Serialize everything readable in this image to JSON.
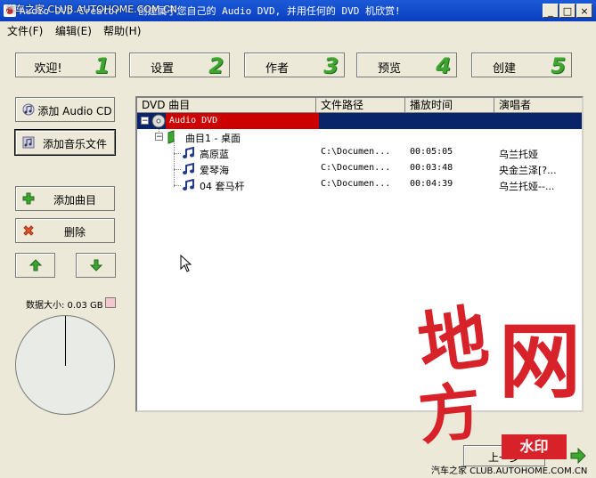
{
  "window": {
    "title": "Audio DVD Creator - 创建属于您自己的 Audio DVD, 并用任何的 DVD 机欣赏!",
    "overlay_text": "汽车之家 CLUB.AUTOHOME.COM.CN"
  },
  "window_controls": {
    "minimize": "_",
    "maximize": "□",
    "close": "×"
  },
  "menu": {
    "items": [
      "文件(F)",
      "编辑(E)",
      "帮助(H)"
    ]
  },
  "steps": [
    {
      "label": "欢迎!",
      "number": "1"
    },
    {
      "label": "设置",
      "number": "2"
    },
    {
      "label": "作者",
      "number": "3"
    },
    {
      "label": "预览",
      "number": "4"
    },
    {
      "label": "创建",
      "number": "5"
    }
  ],
  "side_buttons": {
    "add_audio_cd": "添加 Audio CD",
    "add_music_file": "添加音乐文件",
    "add_track": "添加曲目",
    "delete": "删除"
  },
  "data_size": {
    "label": "数据大小: 0.03 GB",
    "used_fraction": 0.0
  },
  "table": {
    "columns": [
      "DVD 曲目",
      "文件路径",
      "播放时间",
      "演唱者"
    ],
    "root": {
      "label": "Audio DVD"
    },
    "group": {
      "label": "曲目1 - 桌面"
    },
    "rows": [
      {
        "title": "高原蓝",
        "path": "C:\\Documen...",
        "time": "00:05:05",
        "artist": "乌兰托娅"
      },
      {
        "title": "爱琴海",
        "path": "C:\\Documen...",
        "time": "00:03:48",
        "artist": "央金兰泽[?..."
      },
      {
        "title": "04 套马杆",
        "path": "C:\\Documen...",
        "time": "00:04:39",
        "artist": "乌兰托娅--..."
      }
    ]
  },
  "nav": {
    "prev_label": "上一步"
  },
  "watermark": {
    "chars": [
      "地",
      "方",
      "网"
    ],
    "tag": "水印",
    "footer": "汽车之家 CLUB.AUTOHOME.COM.CN"
  },
  "colors": {
    "step_number": "#3ea530",
    "selection": "#0a246a",
    "root_highlight": "#cc0000",
    "watermark": "#d7222a"
  }
}
